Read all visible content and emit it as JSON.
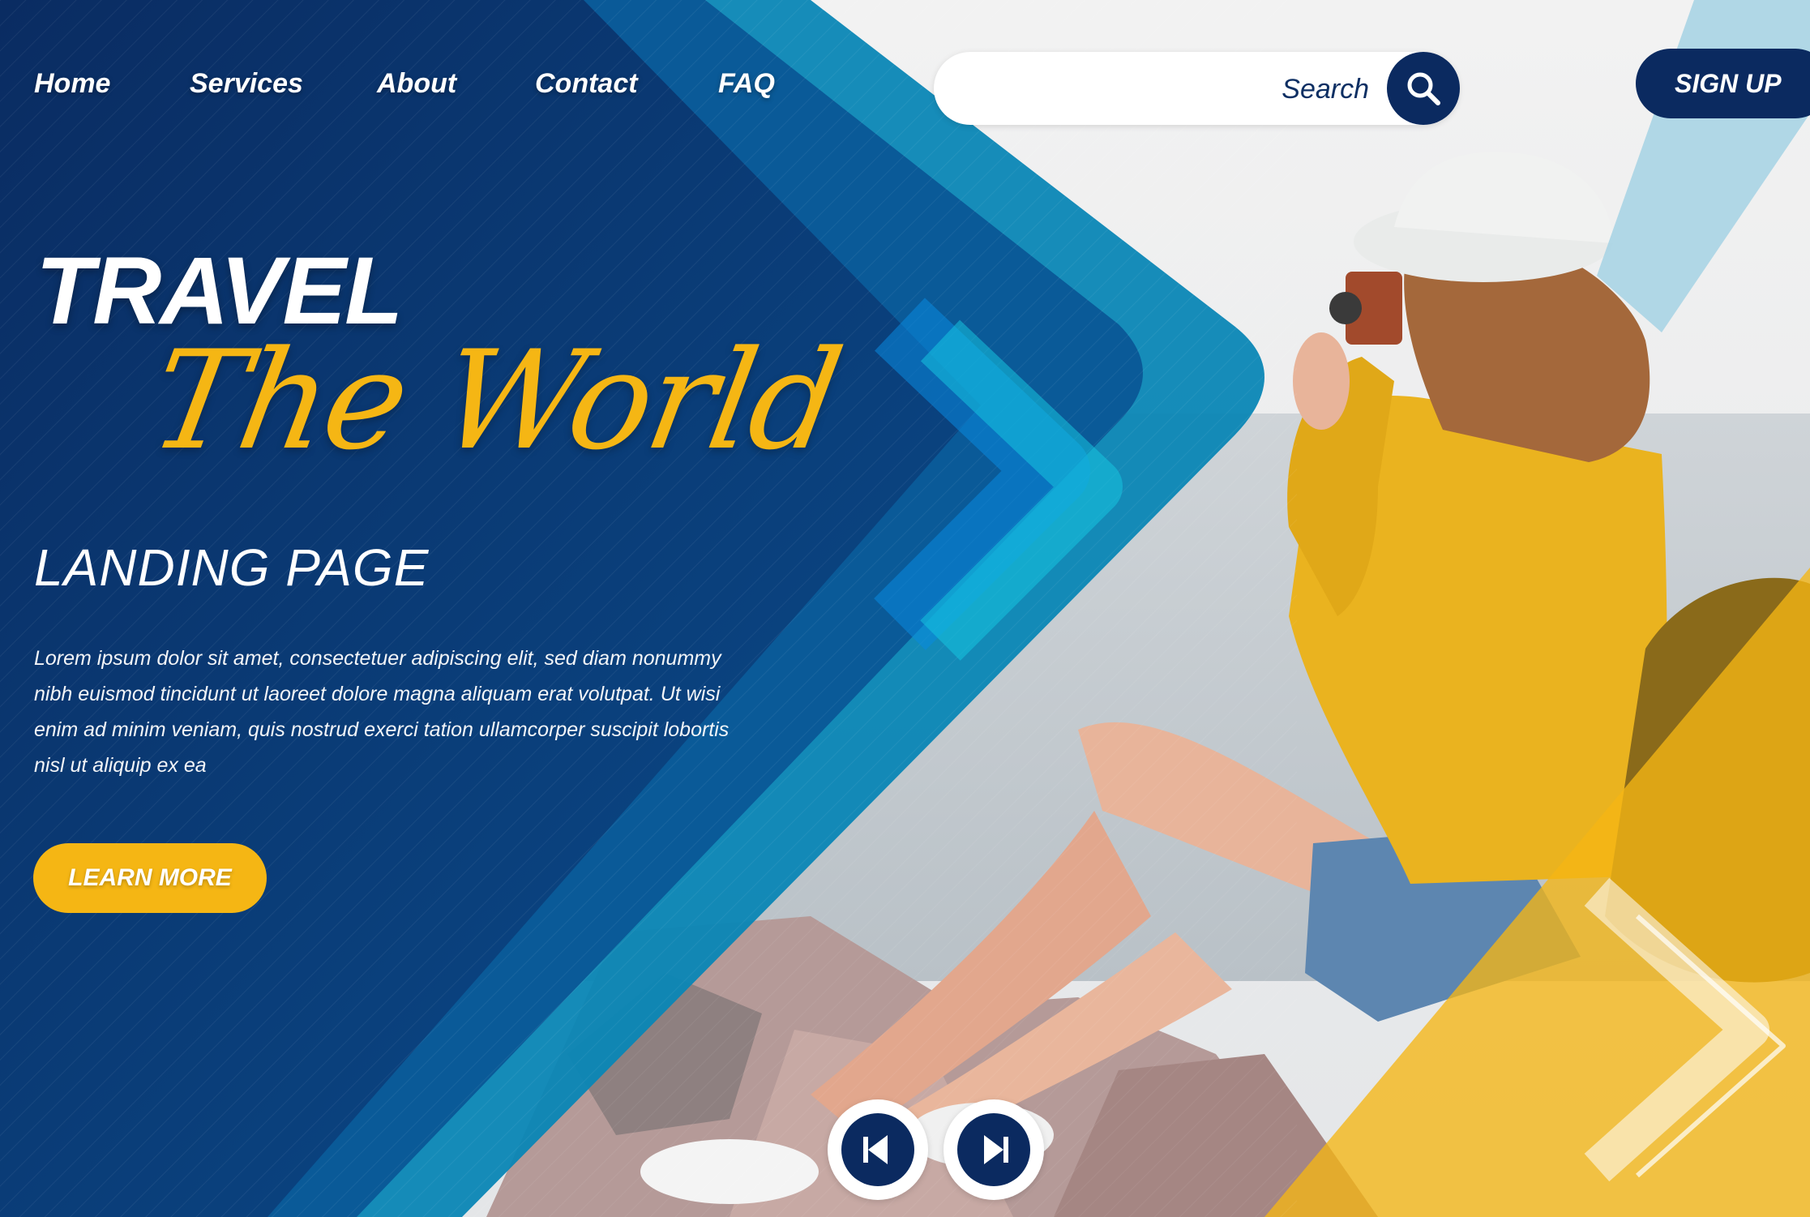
{
  "nav": {
    "items": [
      {
        "label": "Home"
      },
      {
        "label": "Services"
      },
      {
        "label": "About"
      },
      {
        "label": "Contact"
      },
      {
        "label": "FAQ"
      }
    ]
  },
  "search": {
    "placeholder": "Search",
    "icon": "search-icon"
  },
  "header": {
    "signup_label": "SIGN UP"
  },
  "hero": {
    "title_line1": "TRAVEL",
    "title_line2": "The World",
    "subtitle": "LANDING PAGE",
    "body": "Lorem ipsum dolor sit amet, consectetuer adipiscing elit, sed diam nonummy nibh euismod tincidunt ut laoreet dolore magna aliquam erat volutpat. Ut wisi enim ad minim veniam, quis nostrud exerci tation ullamcorper suscipit lobortis nisl ut aliquip ex ea",
    "cta_label": "LEARN MORE"
  },
  "slider": {
    "prev_icon": "chevron-left-icon",
    "next_icon": "chevron-right-icon"
  },
  "colors": {
    "navy": "#0b2a60",
    "blue": "#0a4f8c",
    "teal": "#0a8cb8",
    "yellow": "#f5b614",
    "white": "#ffffff"
  }
}
